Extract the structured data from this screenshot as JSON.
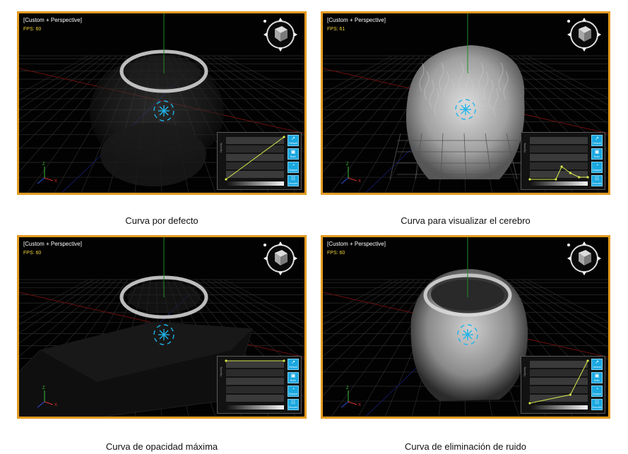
{
  "panels": [
    {
      "viewport_title": "[Custom + Perspective]",
      "fps": "FPS: 60",
      "caption": "Curva por defecto",
      "render_style": "default",
      "curve": [
        [
          0.0,
          0.0
        ],
        [
          1.0,
          1.0
        ]
      ],
      "buttons": [
        "Default",
        "Brain",
        "Opaque",
        "Denoise"
      ]
    },
    {
      "viewport_title": "[Custom + Perspective]",
      "fps": "FPS: 61",
      "caption": "Curva para visualizar el cerebro",
      "render_style": "brain",
      "curve": [
        [
          0.0,
          0.0
        ],
        [
          0.45,
          0.0
        ],
        [
          0.55,
          0.3
        ],
        [
          0.7,
          0.15
        ],
        [
          0.85,
          0.05
        ],
        [
          1.0,
          0.05
        ]
      ],
      "buttons": [
        "Default",
        "Brain",
        "Opaque",
        "Denoise"
      ]
    },
    {
      "viewport_title": "[Custom + Perspective]",
      "fps": "FPS: 60",
      "caption": "Curva de opacidad máxima",
      "render_style": "opaque",
      "curve": [
        [
          0.0,
          1.0
        ],
        [
          1.0,
          1.0
        ]
      ],
      "buttons": [
        "Default",
        "Brain",
        "Opaque",
        "Denoise"
      ]
    },
    {
      "viewport_title": "[Custom + Perspective]",
      "fps": "FPS: 60",
      "caption": "Curva de eliminación de ruido",
      "render_style": "denoise",
      "curve": [
        [
          0.0,
          0.0
        ],
        [
          0.7,
          0.2
        ],
        [
          1.0,
          1.0
        ]
      ],
      "buttons": [
        "Default",
        "Brain",
        "Opaque",
        "Denoise"
      ]
    }
  ],
  "curve_axis_label": "Opacity",
  "colors": {
    "frame": "#e39b1f",
    "fps": "#f2d33a",
    "curve": "#d7e84a",
    "button": "#1aa7e0",
    "gizmo": "#1fb3ea"
  },
  "icons": {
    "view_cube": "view-cube-icon",
    "move_gizmo": "move-gizmo-icon",
    "axis_triad": "axis-triad-icon"
  }
}
